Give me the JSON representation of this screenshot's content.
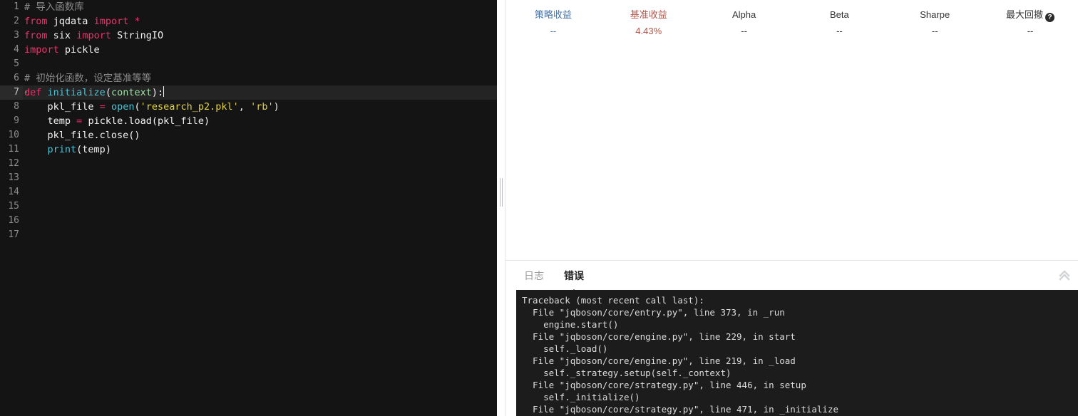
{
  "editor": {
    "lines": [
      {
        "n": "1",
        "active": false,
        "fold": false,
        "tokens": [
          {
            "t": "comment",
            "v": "# 导入函数库"
          }
        ]
      },
      {
        "n": "2",
        "active": false,
        "fold": false,
        "tokens": [
          {
            "t": "keyword",
            "v": "from"
          },
          {
            "t": "plain",
            "v": " "
          },
          {
            "t": "var",
            "v": "jqdata"
          },
          {
            "t": "plain",
            "v": " "
          },
          {
            "t": "keyword",
            "v": "import"
          },
          {
            "t": "plain",
            "v": " "
          },
          {
            "t": "op",
            "v": "*"
          }
        ]
      },
      {
        "n": "3",
        "active": false,
        "fold": false,
        "tokens": [
          {
            "t": "keyword",
            "v": "from"
          },
          {
            "t": "plain",
            "v": " "
          },
          {
            "t": "var",
            "v": "six"
          },
          {
            "t": "plain",
            "v": " "
          },
          {
            "t": "keyword",
            "v": "import"
          },
          {
            "t": "plain",
            "v": " "
          },
          {
            "t": "var",
            "v": "StringIO"
          }
        ]
      },
      {
        "n": "4",
        "active": false,
        "fold": false,
        "tokens": [
          {
            "t": "keyword",
            "v": "import"
          },
          {
            "t": "plain",
            "v": " "
          },
          {
            "t": "var",
            "v": "pickle"
          }
        ]
      },
      {
        "n": "5",
        "active": false,
        "fold": false,
        "tokens": []
      },
      {
        "n": "6",
        "active": false,
        "fold": false,
        "tokens": [
          {
            "t": "comment",
            "v": "# 初始化函数，设定基准等等"
          }
        ]
      },
      {
        "n": "7",
        "active": true,
        "fold": true,
        "caret": true,
        "tokens": [
          {
            "t": "keyword",
            "v": "def"
          },
          {
            "t": "plain",
            "v": " "
          },
          {
            "t": "fn",
            "v": "initialize"
          },
          {
            "t": "plain",
            "v": "("
          },
          {
            "t": "param",
            "v": "context"
          },
          {
            "t": "plain",
            "v": "):"
          }
        ]
      },
      {
        "n": "8",
        "active": false,
        "fold": false,
        "tokens": [
          {
            "t": "plain",
            "v": "    "
          },
          {
            "t": "var",
            "v": "pkl_file"
          },
          {
            "t": "plain",
            "v": " "
          },
          {
            "t": "op",
            "v": "="
          },
          {
            "t": "plain",
            "v": " "
          },
          {
            "t": "builtin",
            "v": "open"
          },
          {
            "t": "plain",
            "v": "("
          },
          {
            "t": "string",
            "v": "'research_p2.pkl'"
          },
          {
            "t": "plain",
            "v": ", "
          },
          {
            "t": "string",
            "v": "'rb'"
          },
          {
            "t": "plain",
            "v": ")"
          }
        ]
      },
      {
        "n": "9",
        "active": false,
        "fold": false,
        "tokens": [
          {
            "t": "plain",
            "v": "    "
          },
          {
            "t": "var",
            "v": "temp"
          },
          {
            "t": "plain",
            "v": " "
          },
          {
            "t": "op",
            "v": "="
          },
          {
            "t": "plain",
            "v": " "
          },
          {
            "t": "var",
            "v": "pickle.load(pkl_file)"
          }
        ]
      },
      {
        "n": "10",
        "active": false,
        "fold": false,
        "tokens": [
          {
            "t": "plain",
            "v": "    "
          },
          {
            "t": "var",
            "v": "pkl_file.close()"
          }
        ]
      },
      {
        "n": "11",
        "active": false,
        "fold": false,
        "tokens": [
          {
            "t": "plain",
            "v": "    "
          },
          {
            "t": "builtin",
            "v": "print"
          },
          {
            "t": "plain",
            "v": "("
          },
          {
            "t": "var",
            "v": "temp"
          },
          {
            "t": "plain",
            "v": ")"
          }
        ]
      },
      {
        "n": "12",
        "active": false,
        "fold": false,
        "tokens": []
      },
      {
        "n": "13",
        "active": false,
        "fold": false,
        "tokens": []
      },
      {
        "n": "14",
        "active": false,
        "fold": false,
        "tokens": []
      },
      {
        "n": "15",
        "active": false,
        "fold": false,
        "tokens": []
      },
      {
        "n": "16",
        "active": false,
        "fold": false,
        "tokens": []
      },
      {
        "n": "17",
        "active": false,
        "fold": false,
        "tokens": []
      }
    ]
  },
  "metrics": [
    {
      "label": "策略收益",
      "value": "--",
      "accent": "accent-blue",
      "help": false
    },
    {
      "label": "基准收益",
      "value": "4.43%",
      "accent": "accent-red",
      "help": false
    },
    {
      "label": "Alpha",
      "value": "--",
      "accent": "",
      "help": false
    },
    {
      "label": "Beta",
      "value": "--",
      "accent": "",
      "help": false
    },
    {
      "label": "Sharpe",
      "value": "--",
      "accent": "",
      "help": false
    },
    {
      "label": "最大回撤",
      "value": "--",
      "accent": "",
      "help": true,
      "help_glyph": "?"
    }
  ],
  "console": {
    "tabs": [
      {
        "label": "日志",
        "active": false
      },
      {
        "label": "错误",
        "active": true
      }
    ],
    "collapse_icon": "double-chevron-up",
    "traceback": [
      "Traceback (most recent call last):",
      "  File \"jqboson/core/entry.py\", line 373, in _run",
      "    engine.start()",
      "  File \"jqboson/core/engine.py\", line 229, in start",
      "    self._load()",
      "  File \"jqboson/core/engine.py\", line 219, in _load",
      "    self._strategy.setup(self._context)",
      "  File \"jqboson/core/strategy.py\", line 446, in setup",
      "    self._initialize()",
      "  File \"jqboson/core/strategy.py\", line 471, in _initialize"
    ]
  },
  "colors": {
    "editor_bg": "#141414",
    "editor_active_line": "#242424",
    "console_bg": "#1c1c1c",
    "accent_blue": "#4472a8",
    "accent_red": "#b3554a",
    "keyword": "#f0306c",
    "string": "#e4d24a",
    "function": "#4fc1d4"
  }
}
